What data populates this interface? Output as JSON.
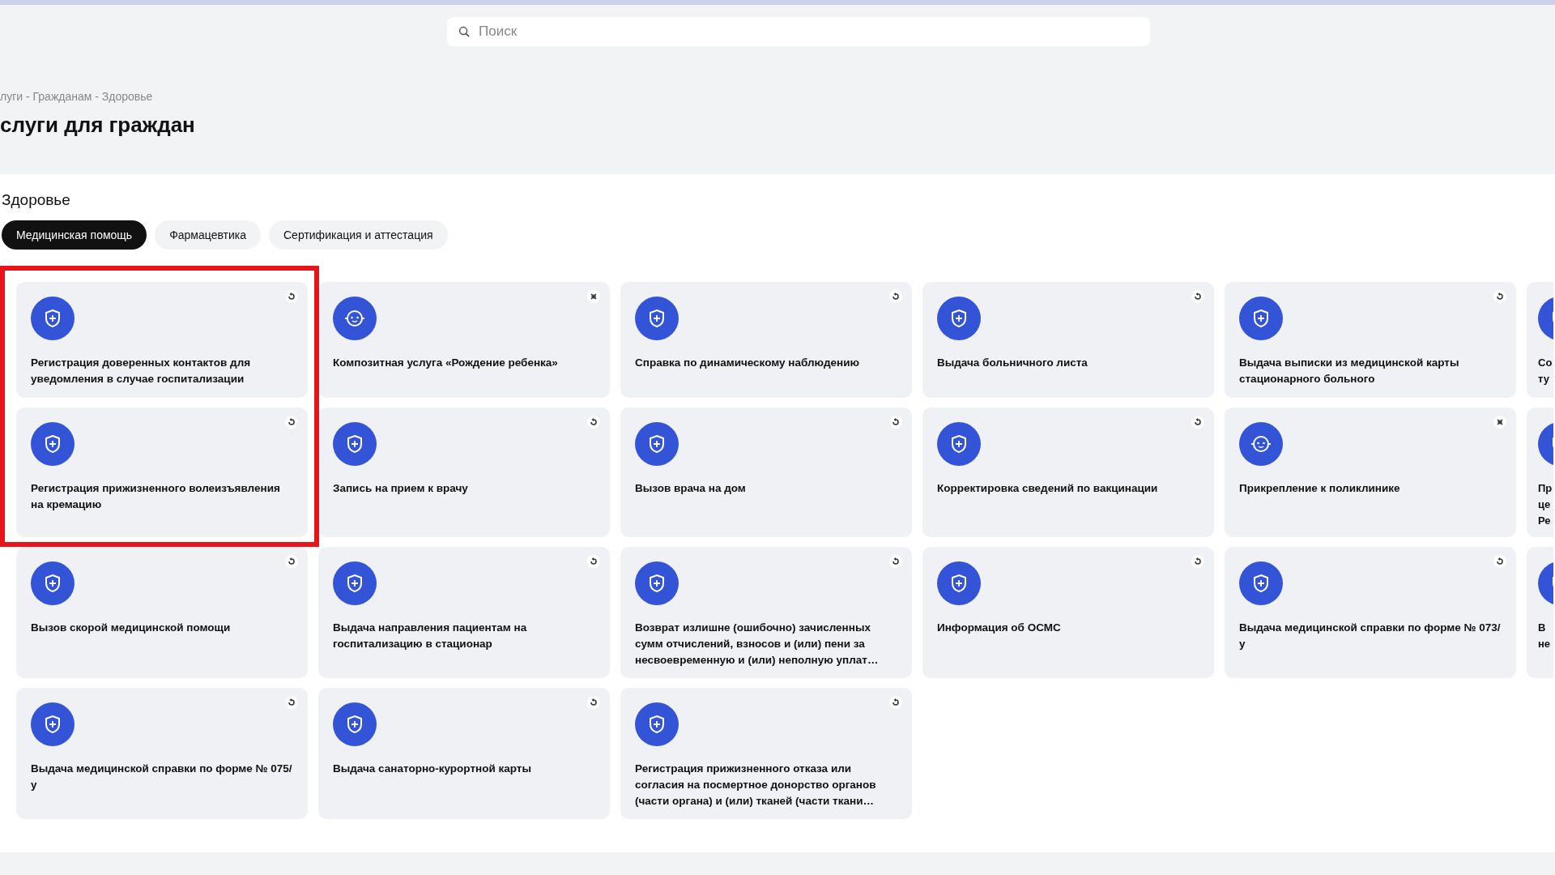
{
  "search": {
    "placeholder": "Поиск"
  },
  "breadcrumb": "луги - Гражданам - Здоровье",
  "title": "слуги для граждан",
  "section": "Здоровье",
  "tabs": [
    {
      "label": "Медицинская помощь",
      "selected": true
    },
    {
      "label": "Фармацевтика",
      "selected": false
    },
    {
      "label": "Сертификация и аттестация",
      "selected": false
    }
  ],
  "cards": [
    {
      "text": "Регистрация доверенных контактов для уведомления в случае госпитализации",
      "kind": "standard",
      "highlighted": true
    },
    {
      "text": "Композитная услуга «Рождение ребенка»",
      "kind": "composite",
      "highlighted": false
    },
    {
      "text": "Справка по динамическому наблюдению",
      "kind": "standard",
      "highlighted": false
    },
    {
      "text": "Выдача больничного листа",
      "kind": "standard",
      "highlighted": false
    },
    {
      "text": "Выдача выписки из медицинской карты стационарного больного",
      "kind": "standard",
      "highlighted": false
    },
    {
      "lines": [
        "Со",
        "ту"
      ],
      "kind": "standard",
      "highlighted": false
    },
    {
      "text": "Регистрация прижизненного волеизъявления на кремацию",
      "kind": "standard",
      "highlighted": true
    },
    {
      "text": "Запись на прием к врачу",
      "kind": "standard",
      "highlighted": false
    },
    {
      "text": "Вызов врача на дом",
      "kind": "standard",
      "highlighted": false
    },
    {
      "text": "Корректировка сведений по вакцинации",
      "kind": "standard",
      "highlighted": false
    },
    {
      "text": "Прикрепление к поликлинике",
      "kind": "composite",
      "highlighted": false
    },
    {
      "lines": [
        "Пр",
        "це",
        "Ре"
      ],
      "kind": "standard",
      "highlighted": false
    },
    {
      "text": "Вызов скорой медицинской помощи",
      "kind": "standard",
      "highlighted": false
    },
    {
      "text": "Выдача направления пациентам на госпитализацию в стационар",
      "kind": "standard",
      "highlighted": false
    },
    {
      "text": "Возврат излишне (ошибочно) зачисленных сумм отчислений, взносов и (или) пени за несвоевременную и (или) неполную уплат…",
      "kind": "standard",
      "highlighted": false
    },
    {
      "text": "Информация об ОСМС",
      "kind": "standard",
      "highlighted": false
    },
    {
      "text": "Выдача медицинской справки по форме № 073/у",
      "kind": "standard",
      "highlighted": false
    },
    {
      "lines": [
        "В",
        "не"
      ],
      "kind": "standard",
      "highlighted": false
    },
    {
      "text": "Выдача медицинской справки по форме № 075/у",
      "kind": "standard",
      "highlighted": false
    },
    {
      "text": "Выдача санаторно-курортной карты",
      "kind": "standard",
      "highlighted": false
    },
    {
      "text": "Регистрация прижизненного отказа или согласия на посмертное донорство органов (части органа) и (или) тканей (части ткани…",
      "kind": "standard",
      "highlighted": false
    }
  ]
}
